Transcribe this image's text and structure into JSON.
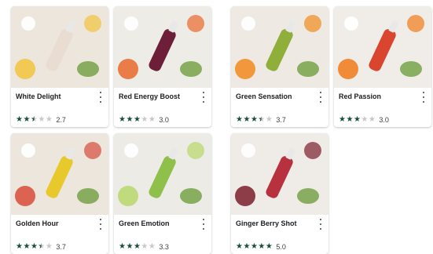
{
  "products": [
    {
      "name": "White Delight",
      "rating": 2.7,
      "rating_label": "2.7",
      "bottle": "#e9ddd2",
      "bg": "#ece6dd",
      "accent": "#f2c33c"
    },
    {
      "name": "Red Energy Boost",
      "rating": 3.0,
      "rating_label": "3.0",
      "bottle": "#6d1f3a",
      "bg": "#eeece7",
      "accent": "#e8692a"
    },
    {
      "name": "Green Sensation",
      "rating": 3.7,
      "rating_label": "3.7",
      "bottle": "#8fae3a",
      "bg": "#eeeae3",
      "accent": "#f08a1c"
    },
    {
      "name": "Red Passion",
      "rating": 3.0,
      "rating_label": "3.0",
      "bottle": "#d9452e",
      "bg": "#f0ede8",
      "accent": "#f07a1a"
    },
    {
      "name": "Golden Hour",
      "rating": 3.7,
      "rating_label": "3.7",
      "bottle": "#e8c92b",
      "bg": "#ece6dc",
      "accent": "#d94b3a"
    },
    {
      "name": "Green Emotion",
      "rating": 3.3,
      "rating_label": "3.3",
      "bottle": "#8ec04a",
      "bg": "#ecebe6",
      "accent": "#b9d86a"
    },
    {
      "name": "Ginger Berry Shot",
      "rating": 5.0,
      "rating_label": "5.0",
      "bottle": "#b8313f",
      "bg": "#efece8",
      "accent": "#7a1e2c"
    }
  ],
  "icons": {
    "more": "more-vert-icon",
    "star": "star-icon"
  }
}
